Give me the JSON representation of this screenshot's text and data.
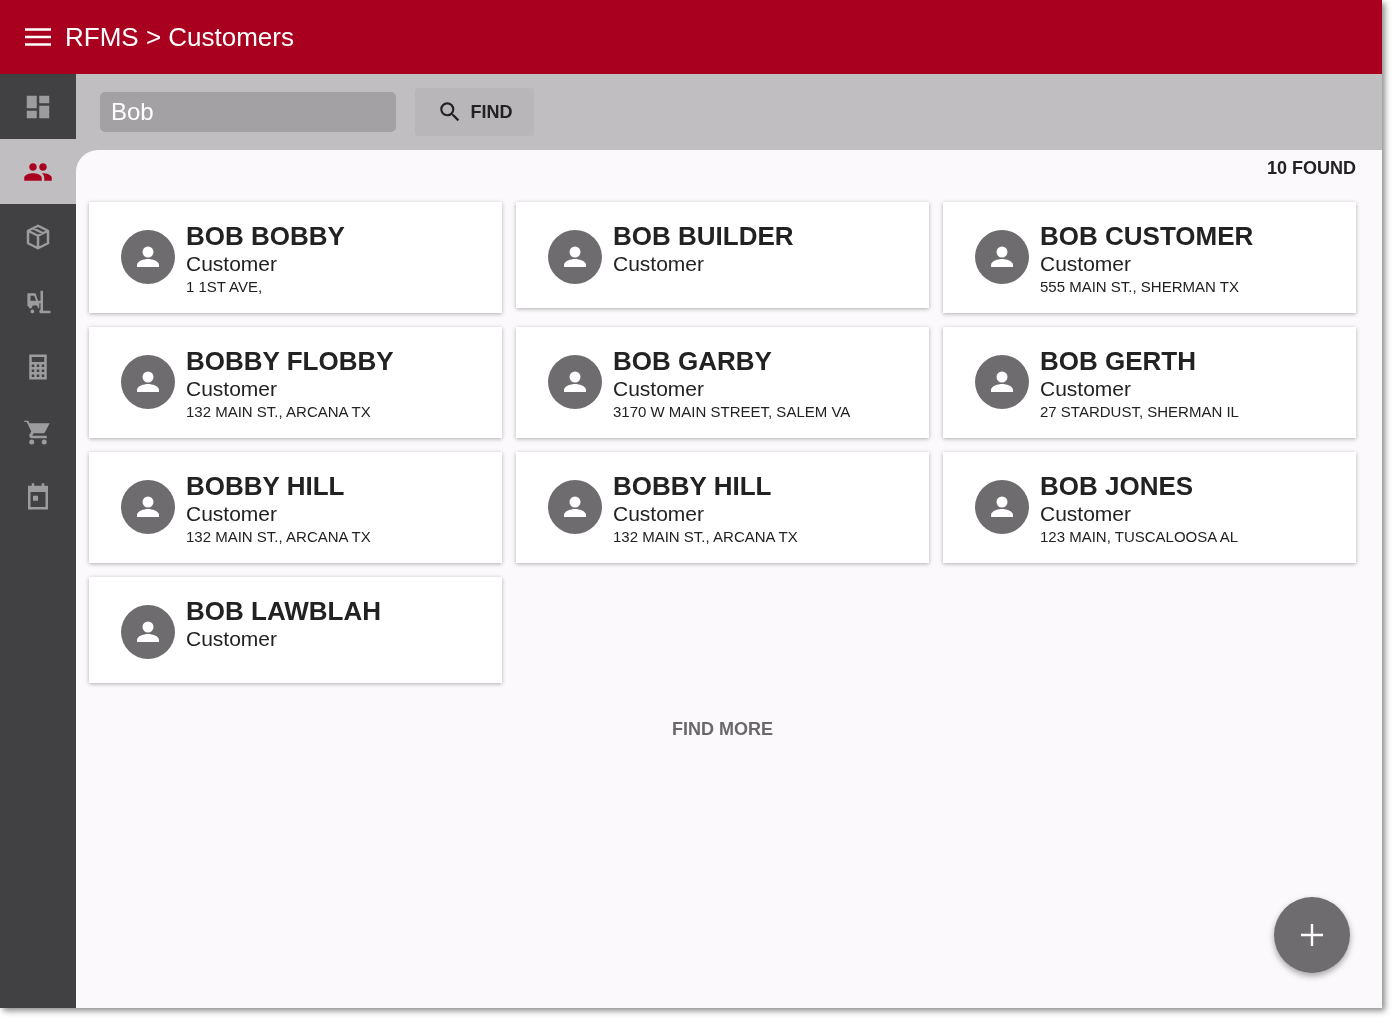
{
  "app_bar": {
    "title": "RFMS > Customers"
  },
  "sidebar": {
    "items": [
      {
        "kind": "dashboard",
        "selected": false
      },
      {
        "kind": "people",
        "selected": true
      },
      {
        "kind": "box",
        "selected": false
      },
      {
        "kind": "forklift",
        "selected": false
      },
      {
        "kind": "calculator",
        "selected": false
      },
      {
        "kind": "cart",
        "selected": false
      },
      {
        "kind": "calendar",
        "selected": false
      }
    ]
  },
  "search": {
    "value": "Bob",
    "button": "FIND"
  },
  "result_count": "10 FOUND",
  "customers": [
    {
      "name": "BOB BOBBY",
      "type": "Customer",
      "address": "1 1ST AVE,"
    },
    {
      "name": "BOB BUILDER",
      "type": "Customer"
    },
    {
      "name": "BOB CUSTOMER",
      "type": "Customer",
      "address": "555 MAIN ST., SHERMAN TX"
    },
    {
      "name": "BOBBY FLOBBY",
      "type": "Customer",
      "address": "132 MAIN ST., ARCANA TX"
    },
    {
      "name": "BOB GARBY",
      "type": "Customer",
      "address": "3170 W MAIN STREET, SALEM VA"
    },
    {
      "name": "BOB GERTH",
      "type": "Customer",
      "address": "27 STARDUST, SHERMAN IL"
    },
    {
      "name": "BOBBY HILL",
      "type": "Customer",
      "address": "132 MAIN ST., ARCANA TX"
    },
    {
      "name": "BOBBY HILL",
      "type": "Customer",
      "address": "132 MAIN ST., ARCANA TX"
    },
    {
      "name": "BOB JONES",
      "type": "Customer",
      "address": "123 MAIN, TUSCALOOSA AL"
    },
    {
      "name": "BOB LAWBLAH",
      "type": "Customer"
    }
  ],
  "find_more": "FIND MORE"
}
